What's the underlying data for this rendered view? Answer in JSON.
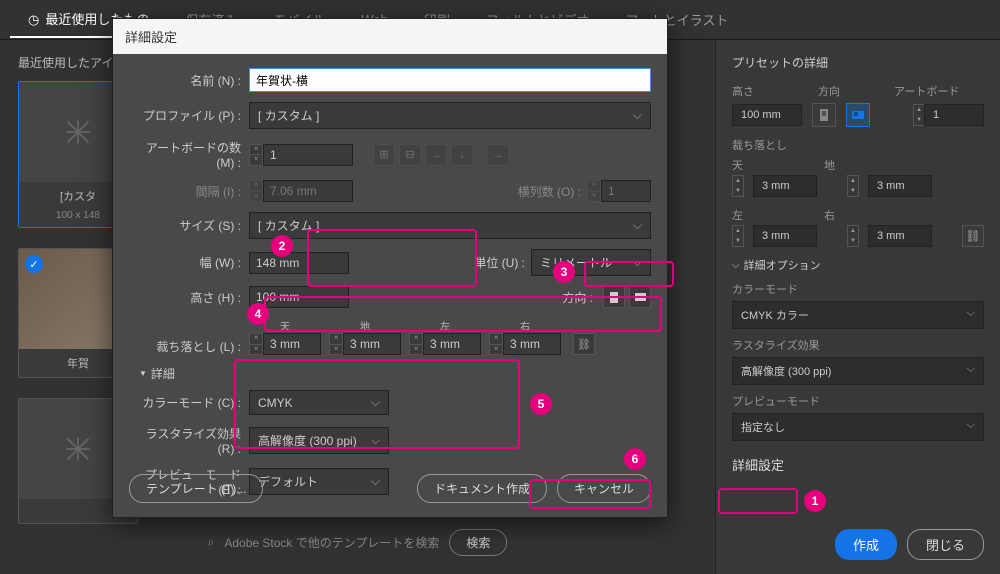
{
  "tabs": {
    "recent": "最近使用したもの",
    "saved": "保存済み",
    "mobile": "モバイル",
    "web": "Web",
    "print": "印刷",
    "film": "フィルムとビデオ",
    "art": "アートとイラスト"
  },
  "left": {
    "recent_label": "最近使用したアイ",
    "thumbs": [
      {
        "label": "[カスタ",
        "size": "100 x 148"
      },
      {
        "label": "年賀"
      }
    ],
    "search_placeholder": "Adobe Stock で他のテンプレートを検索",
    "search_btn": "検索"
  },
  "panel": {
    "title": "プリセットの詳細",
    "height_lbl": "高さ",
    "height_val": "100 mm",
    "orient_lbl": "方向",
    "artboard_lbl": "アートボード",
    "artboard_val": "1",
    "bleed_lbl": "裁ち落とし",
    "top_lbl": "天",
    "bottom_lbl": "地",
    "left_lbl": "左",
    "right_lbl": "右",
    "bleed_val": "3 mm",
    "advanced_lbl": "詳細オプション",
    "color_lbl": "カラーモード",
    "color_val": "CMYK カラー",
    "raster_lbl": "ラスタライズ効果",
    "raster_val": "高解像度 (300 ppi)",
    "preview_lbl": "プレビューモード",
    "preview_val": "指定なし",
    "more_btn": "詳細設定",
    "create_btn": "作成",
    "close_btn": "閉じる"
  },
  "dialog": {
    "title": "詳細設定",
    "name_lbl": "名前 (N) :",
    "name_val": "年賀状-横",
    "profile_lbl": "プロファイル (P) :",
    "profile_val": "[ カスタム ]",
    "artboards_lbl": "アートボードの数 (M) :",
    "artboards_val": "1",
    "spacing_lbl": "間隔 (I) :",
    "spacing_val": "7.06 mm",
    "cols_lbl": "横列数 (O) :",
    "cols_val": "1",
    "size_lbl": "サイズ (S) :",
    "size_val": "[ カスタム ]",
    "width_lbl": "幅 (W) :",
    "width_val": "148 mm",
    "height_lbl": "高さ (H) :",
    "height_val": "100 mm",
    "unit_lbl": "単位 (U) :",
    "unit_val": "ミリメートル",
    "orient_lbl": "方向 :",
    "bleed_lbl": "裁ち落とし (L) :",
    "top_lbl": "天",
    "bottom_lbl": "地",
    "left_lbl": "左",
    "right_lbl": "右",
    "bleed_val": "3 mm",
    "detail_lbl": "詳細",
    "color_lbl": "カラーモード (C) :",
    "color_val": "CMYK",
    "raster_lbl": "ラスタライズ効果 (R) :",
    "raster_val": "高解像度 (300 ppi)",
    "preview_lbl": "プレビューモード (E) :",
    "preview_val": "デフォルト",
    "template_btn": "テンプレート (T)...",
    "create_btn": "ドキュメント作成",
    "cancel_btn": "キャンセル"
  },
  "badges": {
    "b1": "1",
    "b2": "2",
    "b3": "3",
    "b4": "4",
    "b5": "5",
    "b6": "6"
  }
}
